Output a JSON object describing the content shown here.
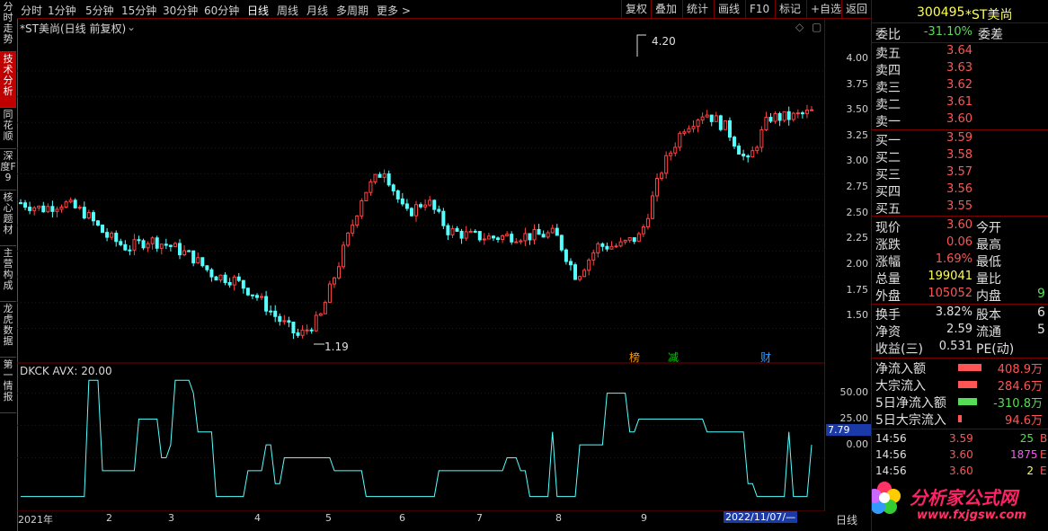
{
  "left_tabs": [
    {
      "label": "分时走势",
      "active": false
    },
    {
      "label": "技术分析",
      "active": true
    },
    {
      "label": "同花顺",
      "active": false
    },
    {
      "label": "深度F9",
      "active": false
    },
    {
      "label": "核心题材",
      "active": false
    },
    {
      "label": "主营构成",
      "active": false
    },
    {
      "label": "龙虎数据",
      "active": false
    },
    {
      "label": "第一情报",
      "active": false
    }
  ],
  "period_tabs": [
    "分时",
    "1分钟",
    "5分钟",
    "15分钟",
    "30分钟",
    "60分钟",
    "日线",
    "周线",
    "月线",
    "多周期",
    "更多 >"
  ],
  "selected_period": "日线",
  "toolbar": [
    "复权",
    "叠加",
    "统计",
    "画线",
    "F10",
    "标记",
    "+自选",
    "返回"
  ],
  "main_chart": {
    "title": "*ST美尚(日线 前复权)",
    "y_ticks": [
      "4.00",
      "3.75",
      "3.50",
      "3.25",
      "3.00",
      "2.75",
      "2.50",
      "2.25",
      "2.00",
      "1.75",
      "1.50"
    ],
    "high_label": "4.20",
    "low_label": "1.19",
    "markers": [
      {
        "text": "榜",
        "color": "#ff9900"
      },
      {
        "text": "减",
        "color": "#00cc00"
      },
      {
        "text": "财",
        "color": "#3399ff"
      }
    ]
  },
  "indicator": {
    "title": "DKCK AVX: 20.00",
    "y_ticks": [
      "50.00",
      "25.00",
      "0.00"
    ],
    "current_value": "7.79"
  },
  "x_axis": {
    "labels": [
      "2021年",
      "2",
      "3",
      "4",
      "5",
      "6",
      "7",
      "8",
      "9"
    ],
    "cursor_date": "2022/11/07/—",
    "period_label": "日线"
  },
  "chart_data": {
    "type": "candlestick",
    "title": "*ST美尚(日线 前复权)",
    "ylim": [
      1.19,
      4.2
    ],
    "annotations": [
      {
        "text": "4.20",
        "kind": "period_high"
      },
      {
        "text": "1.19",
        "kind": "period_low"
      }
    ],
    "month_labels": [
      "2021年",
      "2",
      "3",
      "4",
      "5",
      "6",
      "7",
      "8",
      "9"
    ],
    "approx_close_path": [
      2.72,
      2.66,
      2.72,
      2.62,
      2.4,
      2.28,
      2.36,
      2.3,
      2.2,
      2.02,
      1.97,
      1.82,
      1.6,
      1.42,
      1.6,
      2.2,
      2.8,
      3.05,
      2.6,
      2.75,
      2.45,
      2.4,
      2.38,
      2.4,
      2.4,
      2.42,
      2.0,
      2.3,
      2.3,
      2.4,
      3.05,
      3.45,
      3.6,
      3.45,
      3.1,
      3.55,
      3.55,
      3.6
    ],
    "indicator": {
      "name": "DKCK",
      "avx": 20.0,
      "ylim": [
        -40,
        65
      ],
      "current": 7.79
    }
  },
  "quote_panel": {
    "code": "300495",
    "name": "*ST美尚",
    "weibi_label": "委比",
    "weibi_value": "-31.10%",
    "weicha_label": "委差",
    "asks": [
      {
        "label": "卖五",
        "price": "3.64"
      },
      {
        "label": "卖四",
        "price": "3.63"
      },
      {
        "label": "卖三",
        "price": "3.62"
      },
      {
        "label": "卖二",
        "price": "3.61"
      },
      {
        "label": "卖一",
        "price": "3.60"
      }
    ],
    "bids": [
      {
        "label": "买一",
        "price": "3.59"
      },
      {
        "label": "买二",
        "price": "3.58"
      },
      {
        "label": "买三",
        "price": "3.57"
      },
      {
        "label": "买四",
        "price": "3.56"
      },
      {
        "label": "买五",
        "price": "3.55"
      }
    ],
    "stats": [
      {
        "label": "现价",
        "value": "3.60",
        "label2": "今开",
        "color": "#ff5555"
      },
      {
        "label": "涨跌",
        "value": "0.06",
        "label2": "最高",
        "color": "#ff5555"
      },
      {
        "label": "涨幅",
        "value": "1.69%",
        "label2": "最低",
        "color": "#ff5555"
      },
      {
        "label": "总量",
        "value": "199041",
        "label2": "量比",
        "color": "#ffff55"
      },
      {
        "label": "外盘",
        "value": "105052",
        "label2": "内盘",
        "label2_value": "9",
        "color": "#ff5555"
      }
    ],
    "stats2": [
      {
        "label": "换手",
        "value": "3.82%",
        "label2": "股本",
        "label2_value": "6"
      },
      {
        "label": "净资",
        "value": "2.59",
        "label2": "流通",
        "label2_value": "5"
      },
      {
        "label": "收益(三)",
        "value": "0.531",
        "label2": "PE(动)"
      }
    ],
    "flows": [
      {
        "label": "净流入额",
        "value": "408.9万",
        "sign": "pos",
        "bar": 1.0
      },
      {
        "label": "大宗流入",
        "value": "284.6万",
        "sign": "pos",
        "bar": 0.8
      },
      {
        "label": "5日净流入额",
        "value": "-310.8万",
        "sign": "neg",
        "bar": 0.8
      },
      {
        "label": "5日大宗流入",
        "value": "94.6万",
        "sign": "pos",
        "bar": 0.15
      }
    ],
    "ticks": [
      {
        "time": "14:56",
        "price": "3.59",
        "price_color": "#ff5555",
        "vol": "25",
        "vol_color": "#55dd55",
        "flag": "B"
      },
      {
        "time": "14:56",
        "price": "3.60",
        "price_color": "#ff5555",
        "vol": "1875",
        "vol_color": "#ff55ff",
        "flag": "E"
      },
      {
        "time": "14:56",
        "price": "3.60",
        "price_color": "#ff5555",
        "vol": "2",
        "vol_color": "#ffff55",
        "flag": "E"
      }
    ]
  },
  "watermark": {
    "text": "分析家公式网",
    "url": "www.fxjgsw.com"
  }
}
